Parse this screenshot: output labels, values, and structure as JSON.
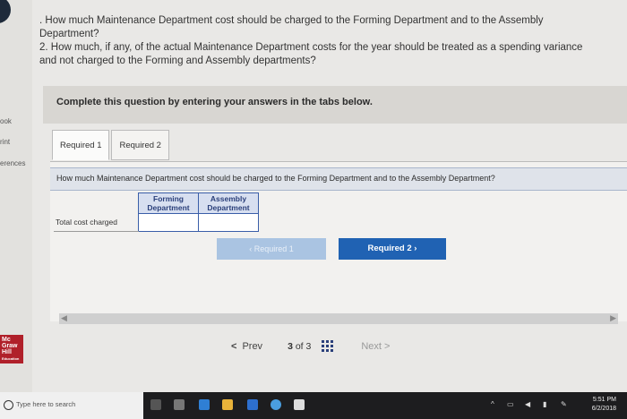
{
  "question": {
    "line1": ". How much Maintenance Department cost should be charged to the Forming Department and to the Assembly",
    "line2": "Department?",
    "line3": "2. How much, if any, of the actual Maintenance Department costs for the year should be treated as a spending variance",
    "line4": "and not charged to the Forming and Assembly departments?"
  },
  "left_rail": {
    "items": [
      "ook",
      "rint",
      "erences"
    ],
    "logo_lines": [
      "Mc",
      "Graw",
      "Hill",
      "Education"
    ]
  },
  "panel": {
    "title": "Complete this question by entering your answers in the tabs below."
  },
  "tabs": [
    {
      "label": "Required 1",
      "active": true
    },
    {
      "label": "Required 2",
      "active": false
    }
  ],
  "content": {
    "prompt": "How much Maintenance Department cost should be charged to the Forming Department and to the Assembly Department?"
  },
  "table": {
    "col1": "Forming Department",
    "col2": "Assembly Department",
    "row_label": "Total cost charged",
    "forming_value": "",
    "assembly_value": ""
  },
  "nav_buttons": {
    "prev_label": "Required 1",
    "next_label": "Required 2"
  },
  "pager": {
    "prev": "Prev",
    "current": "3",
    "of": "of",
    "total": "3",
    "next": "Next"
  },
  "taskbar": {
    "search_placeholder": "Type here to search",
    "time": "5:51 PM",
    "date": "6/2/2018"
  },
  "colors": {
    "accent": "#2062b3",
    "accent_disabled": "#aac4e2",
    "table_border": "#3a5ea8"
  }
}
